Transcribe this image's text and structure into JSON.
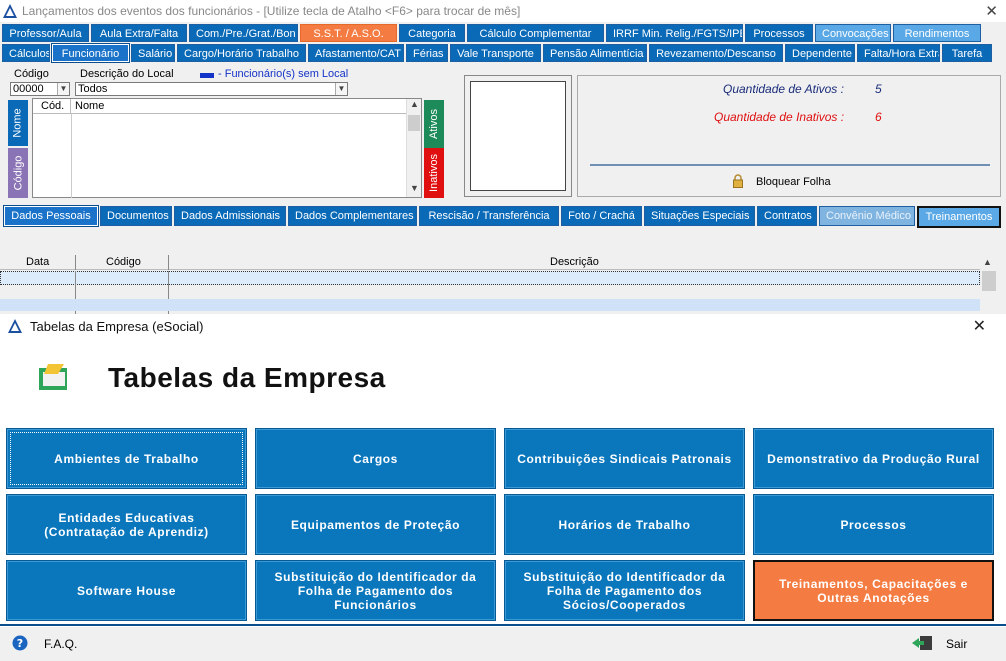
{
  "window": {
    "title": "Lançamentos dos eventos dos funcionários - [Utilize tecla de Atalho <F6> para trocar de mês]"
  },
  "top_tabs": [
    {
      "label": "Professor/Aula",
      "style": "normal"
    },
    {
      "label": "Aula Extra/Falta",
      "style": "normal"
    },
    {
      "label": "Com./Pre./Grat./Bon",
      "style": "normal"
    },
    {
      "label": "S.S.T. / A.S.O.",
      "style": "orange"
    },
    {
      "label": "Categoria",
      "style": "normal"
    },
    {
      "label": "Cálculo Complementar",
      "style": "normal"
    },
    {
      "label": "IRRF Min. Relig./FGTS/IPESP",
      "style": "normal"
    },
    {
      "label": "Processos",
      "style": "normal"
    },
    {
      "label": "Convocações",
      "style": "light"
    },
    {
      "label": "Rendimentos",
      "style": "light"
    }
  ],
  "second_tabs": [
    {
      "label": "Cálculos",
      "style": "normal"
    },
    {
      "label": "Funcionário",
      "style": "active"
    },
    {
      "label": "Salário",
      "style": "normal"
    },
    {
      "label": "Cargo/Horário Trabalho",
      "style": "normal"
    },
    {
      "label": "Afastamento/CAT",
      "style": "normal"
    },
    {
      "label": "Férias",
      "style": "normal"
    },
    {
      "label": "Vale Transporte",
      "style": "normal"
    },
    {
      "label": "Pensão Alimentícia",
      "style": "normal"
    },
    {
      "label": "Revezamento/Descanso",
      "style": "normal"
    },
    {
      "label": "Dependente",
      "style": "normal"
    },
    {
      "label": "Falta/Hora Extra",
      "style": "normal"
    },
    {
      "label": "Tarefa",
      "style": "normal"
    }
  ],
  "filter": {
    "codigo_label": "Código",
    "descricao_label": "Descrição do Local",
    "legend_text": "- Funcionário(s) sem Local",
    "codigo_value": "00000",
    "descricao_value": "Todos",
    "col_cod": "Cód.",
    "col_nome": "Nome",
    "vtab_nome": "Nome",
    "vtab_codigo": "Código",
    "vtab_ativos": "Ativos",
    "vtab_inativos": "Inativos"
  },
  "stats": {
    "ativos_label": "Quantidade de Ativos :",
    "ativos_value": "5",
    "inativos_label": "Quantidade de Inativos :",
    "inativos_value": "6",
    "bloquear_label": "Bloquear Folha"
  },
  "detail_tabs": [
    {
      "label": "Dados Pessoais",
      "style": "active"
    },
    {
      "label": "Documentos",
      "style": "normal"
    },
    {
      "label": "Dados Admissionais",
      "style": "normal"
    },
    {
      "label": "Dados Complementares",
      "style": "normal"
    },
    {
      "label": "Rescisão / Transferência",
      "style": "normal"
    },
    {
      "label": "Foto / Crachá",
      "style": "normal"
    },
    {
      "label": "Situações Especiais",
      "style": "normal"
    },
    {
      "label": "Contratos",
      "style": "normal"
    },
    {
      "label": "Convênio Médico",
      "style": "dim"
    },
    {
      "label": "Treinamentos",
      "style": "light"
    }
  ],
  "events_grid": {
    "col_data": "Data",
    "col_codigo": "Código",
    "col_descricao": "Descrição"
  },
  "dialog": {
    "title": "Tabelas da Empresa (eSocial)",
    "heading": "Tabelas da Empresa",
    "buttons": [
      {
        "label": "Ambientes de Trabalho",
        "style": "focused"
      },
      {
        "label": "Cargos",
        "style": "normal"
      },
      {
        "label": "Contribuições Sindicais Patronais",
        "style": "normal"
      },
      {
        "label": "Demonstrativo da Produção Rural",
        "style": "normal"
      },
      {
        "label": "Entidades Educativas (Contratação de Aprendiz)",
        "style": "normal"
      },
      {
        "label": "Equipamentos de Proteção",
        "style": "normal"
      },
      {
        "label": "Horários de Trabalho",
        "style": "normal"
      },
      {
        "label": "Processos",
        "style": "normal"
      },
      {
        "label": "Software House",
        "style": "normal"
      },
      {
        "label": "Substituição do Identificador da Folha de Pagamento dos Funcionários",
        "style": "normal"
      },
      {
        "label": "Substituição do Identificador da Folha de Pagamento dos Sócios/Cooperados",
        "style": "normal"
      },
      {
        "label": "Treinamentos, Capacitações e Outras Anotações",
        "style": "orange"
      }
    ],
    "faq_label": "F.A.Q.",
    "sair_label": "Sair"
  },
  "colors": {
    "tab_blue": "#0a6ab8",
    "tab_orange": "#f47c42",
    "button_blue": "#0a77bd",
    "ativos_color": "#1a2c7a",
    "inativos_color": "#e01010"
  }
}
